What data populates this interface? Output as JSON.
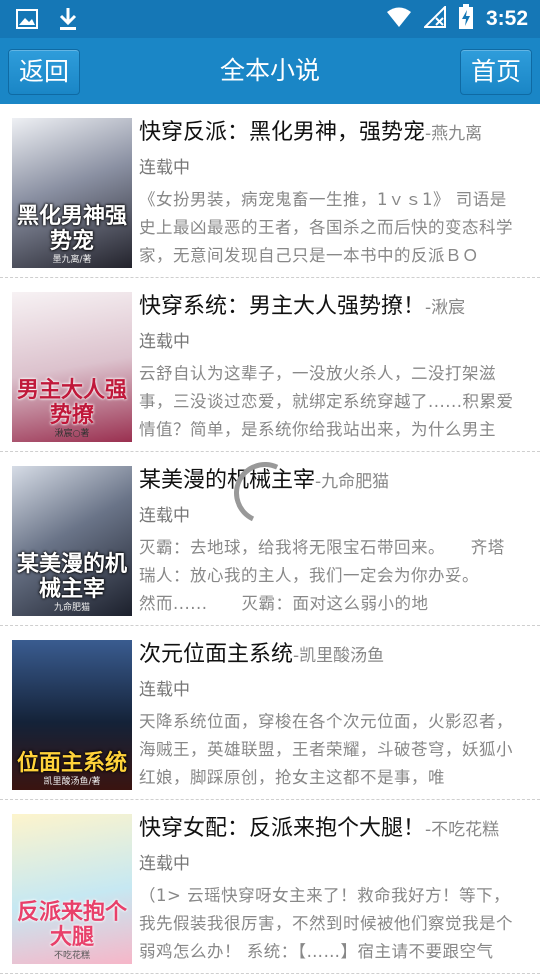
{
  "status_bar": {
    "time": "3:52",
    "icons": [
      "image-icon",
      "download-icon",
      "wifi-icon",
      "no-sim-icon",
      "battery-charging-icon"
    ]
  },
  "header": {
    "back_label": "返回",
    "title": "全本小说",
    "home_label": "首页"
  },
  "books": [
    {
      "title": "快穿反派：黑化男神，强势宠",
      "author": "-燕九离",
      "status": "连载中",
      "desc": "《女扮男装，病宠鬼畜一生推，1ｖｓ1》 司语是史上最凶最恶的王者，各国杀之而后快的变态科学家，无意间发现自己只是一本书中的反派ＢＯ",
      "cover_text": "黑化男神强势宠",
      "cover_author": "墨九离/著",
      "cover_colors": [
        "#e8e8ee",
        "#6b6f80",
        "#1c1c24"
      ]
    },
    {
      "title": "快穿系统：男主大人强势撩！",
      "author": "-湫宸",
      "status": "连载中",
      "desc": "云舒自认为这辈子，一没放火杀人，二没打架滋事，三没谈过恋爱，就绑定系统穿越了......积累爱情值？简单，是系统你给我站出来，为什么男主",
      "cover_text": "男主大人强势撩",
      "cover_author": "湫宸○著",
      "cover_colors": [
        "#f4eef0",
        "#d8b8c6",
        "#8a2040"
      ]
    },
    {
      "title": "某美漫的机械主宰",
      "author": "-九命肥猫",
      "status": "连载中",
      "desc": "灭霸：去地球，给我将无限宝石带回来。　　齐塔瑞人：放心我的主人，我们一定会为你办妥。　　然而......　　灭霸：面对这么弱小的地",
      "cover_text": "某美漫的机械主宰",
      "cover_author": "九命肥猫",
      "cover_colors": [
        "#cfd6e0",
        "#5a6478",
        "#1a1e2a"
      ]
    },
    {
      "title": "次元位面主系统",
      "author": "-凯里酸汤鱼",
      "status": "连载中",
      "desc": "天降系统位面，穿梭在各个次元位面，火影忍者，海贼王，英雄联盟，王者荣耀，斗破苍穹，妖狐小红娘，脚踩原创，抢女主这都不是事，唯",
      "cover_text": "位面主系统",
      "cover_author": "凯里酸汤鱼/著",
      "cover_colors": [
        "#2a4a7a",
        "#101a30",
        "#c03020"
      ]
    },
    {
      "title": "快穿女配：反派来抱个大腿！",
      "author": "-不吃花糕",
      "status": "连载中",
      "desc": "（1> 云瑶快穿呀女主来了！救命我好方！等下，我先假装我很厉害，不然到时候被他们察觉我是个弱鸡怎么办！ 系统：【……】宿主请不要跟空气",
      "cover_text": "反派来抱个大腿",
      "cover_author": "不吃花糕",
      "cover_colors": [
        "#fdf3c8",
        "#bfe6f0",
        "#f07aa0"
      ]
    }
  ]
}
